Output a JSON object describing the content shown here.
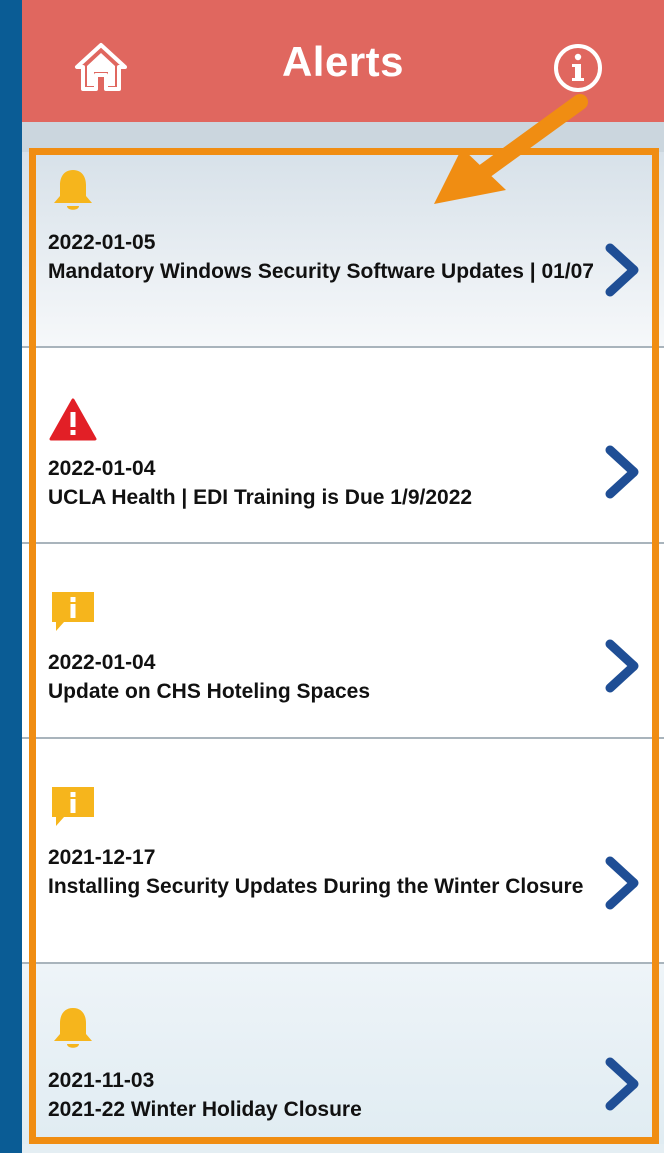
{
  "header": {
    "title": "Alerts",
    "home_icon": "home-icon",
    "info_icon": "info-icon",
    "background_color": "#e0675f"
  },
  "alerts": [
    {
      "date": "2022-01-05",
      "title": "Mandatory Windows Security Software Updates | 01/07",
      "icon": "bell-icon"
    },
    {
      "date": "2022-01-04",
      "title": "UCLA Health | EDI Training is Due 1/9/2022",
      "icon": "warning-icon"
    },
    {
      "date": "2022-01-04",
      "title": "Update on CHS Hoteling Spaces",
      "icon": "info-message-icon"
    },
    {
      "date": "2021-12-17",
      "title": "Installing Security Updates During the Winter Closure",
      "icon": "info-message-icon"
    },
    {
      "date": "2021-11-03",
      "title": "2021-22 Winter Holiday Closure",
      "icon": "bell-icon"
    }
  ],
  "colors": {
    "highlight": "#f08d12",
    "chevron": "#1f4e95",
    "bell": "#f6b51c",
    "warning": "#e21f26"
  }
}
